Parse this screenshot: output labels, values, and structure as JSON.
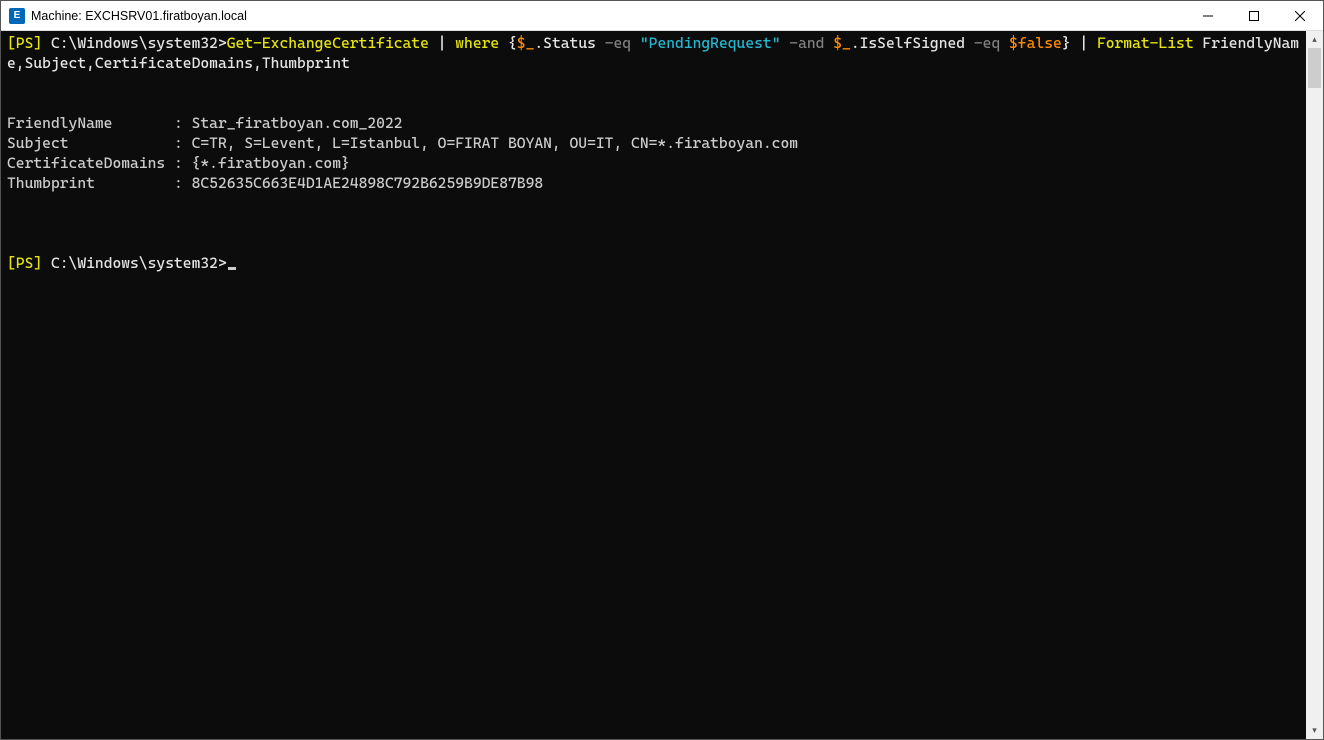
{
  "titlebar": {
    "icon_letter": "E",
    "title": "Machine: EXCHSRV01.firatboyan.local"
  },
  "terminal": {
    "line1": {
      "prompt_open": "[",
      "prompt_ps": "PS",
      "prompt_close": "] ",
      "path": "C:\\Windows\\system32>",
      "cmd": "Get-ExchangeCertificate",
      "pipe1": " | ",
      "where": "where",
      "brace_open": " {",
      "var1": "$_",
      "prop1": ".Status ",
      "op1": "-eq",
      "sp1": " ",
      "str1": "\"PendingRequest\"",
      "sp2": " ",
      "and": "-and",
      "sp3": " ",
      "var2": "$_",
      "prop2": ".IsSelfSigned ",
      "op2": "-eq",
      "sp4": " ",
      "false": "$false",
      "brace_close": "}",
      "pipe2": " | ",
      "format": "Format-List",
      "fields": " FriendlyName,Subject,CertificateDomains,Thumbprint"
    },
    "output": {
      "friendlyName_label": "FriendlyName       : ",
      "friendlyName_value": "Star_firatboyan.com_2022",
      "subject_label": "Subject            : ",
      "subject_value": "C=TR, S=Levent, L=Istanbul, O=FIRAT BOYAN, OU=IT, CN=*.firatboyan.com",
      "certDomains_label": "CertificateDomains : ",
      "certDomains_value": "{*.firatboyan.com}",
      "thumbprint_label": "Thumbprint         : ",
      "thumbprint_value": "8C52635C663E4D1AE24898C792B6259B9DE87B98"
    },
    "prompt2": {
      "open": "[",
      "ps": "PS",
      "close": "] ",
      "path": "C:\\Windows\\system32>"
    }
  }
}
